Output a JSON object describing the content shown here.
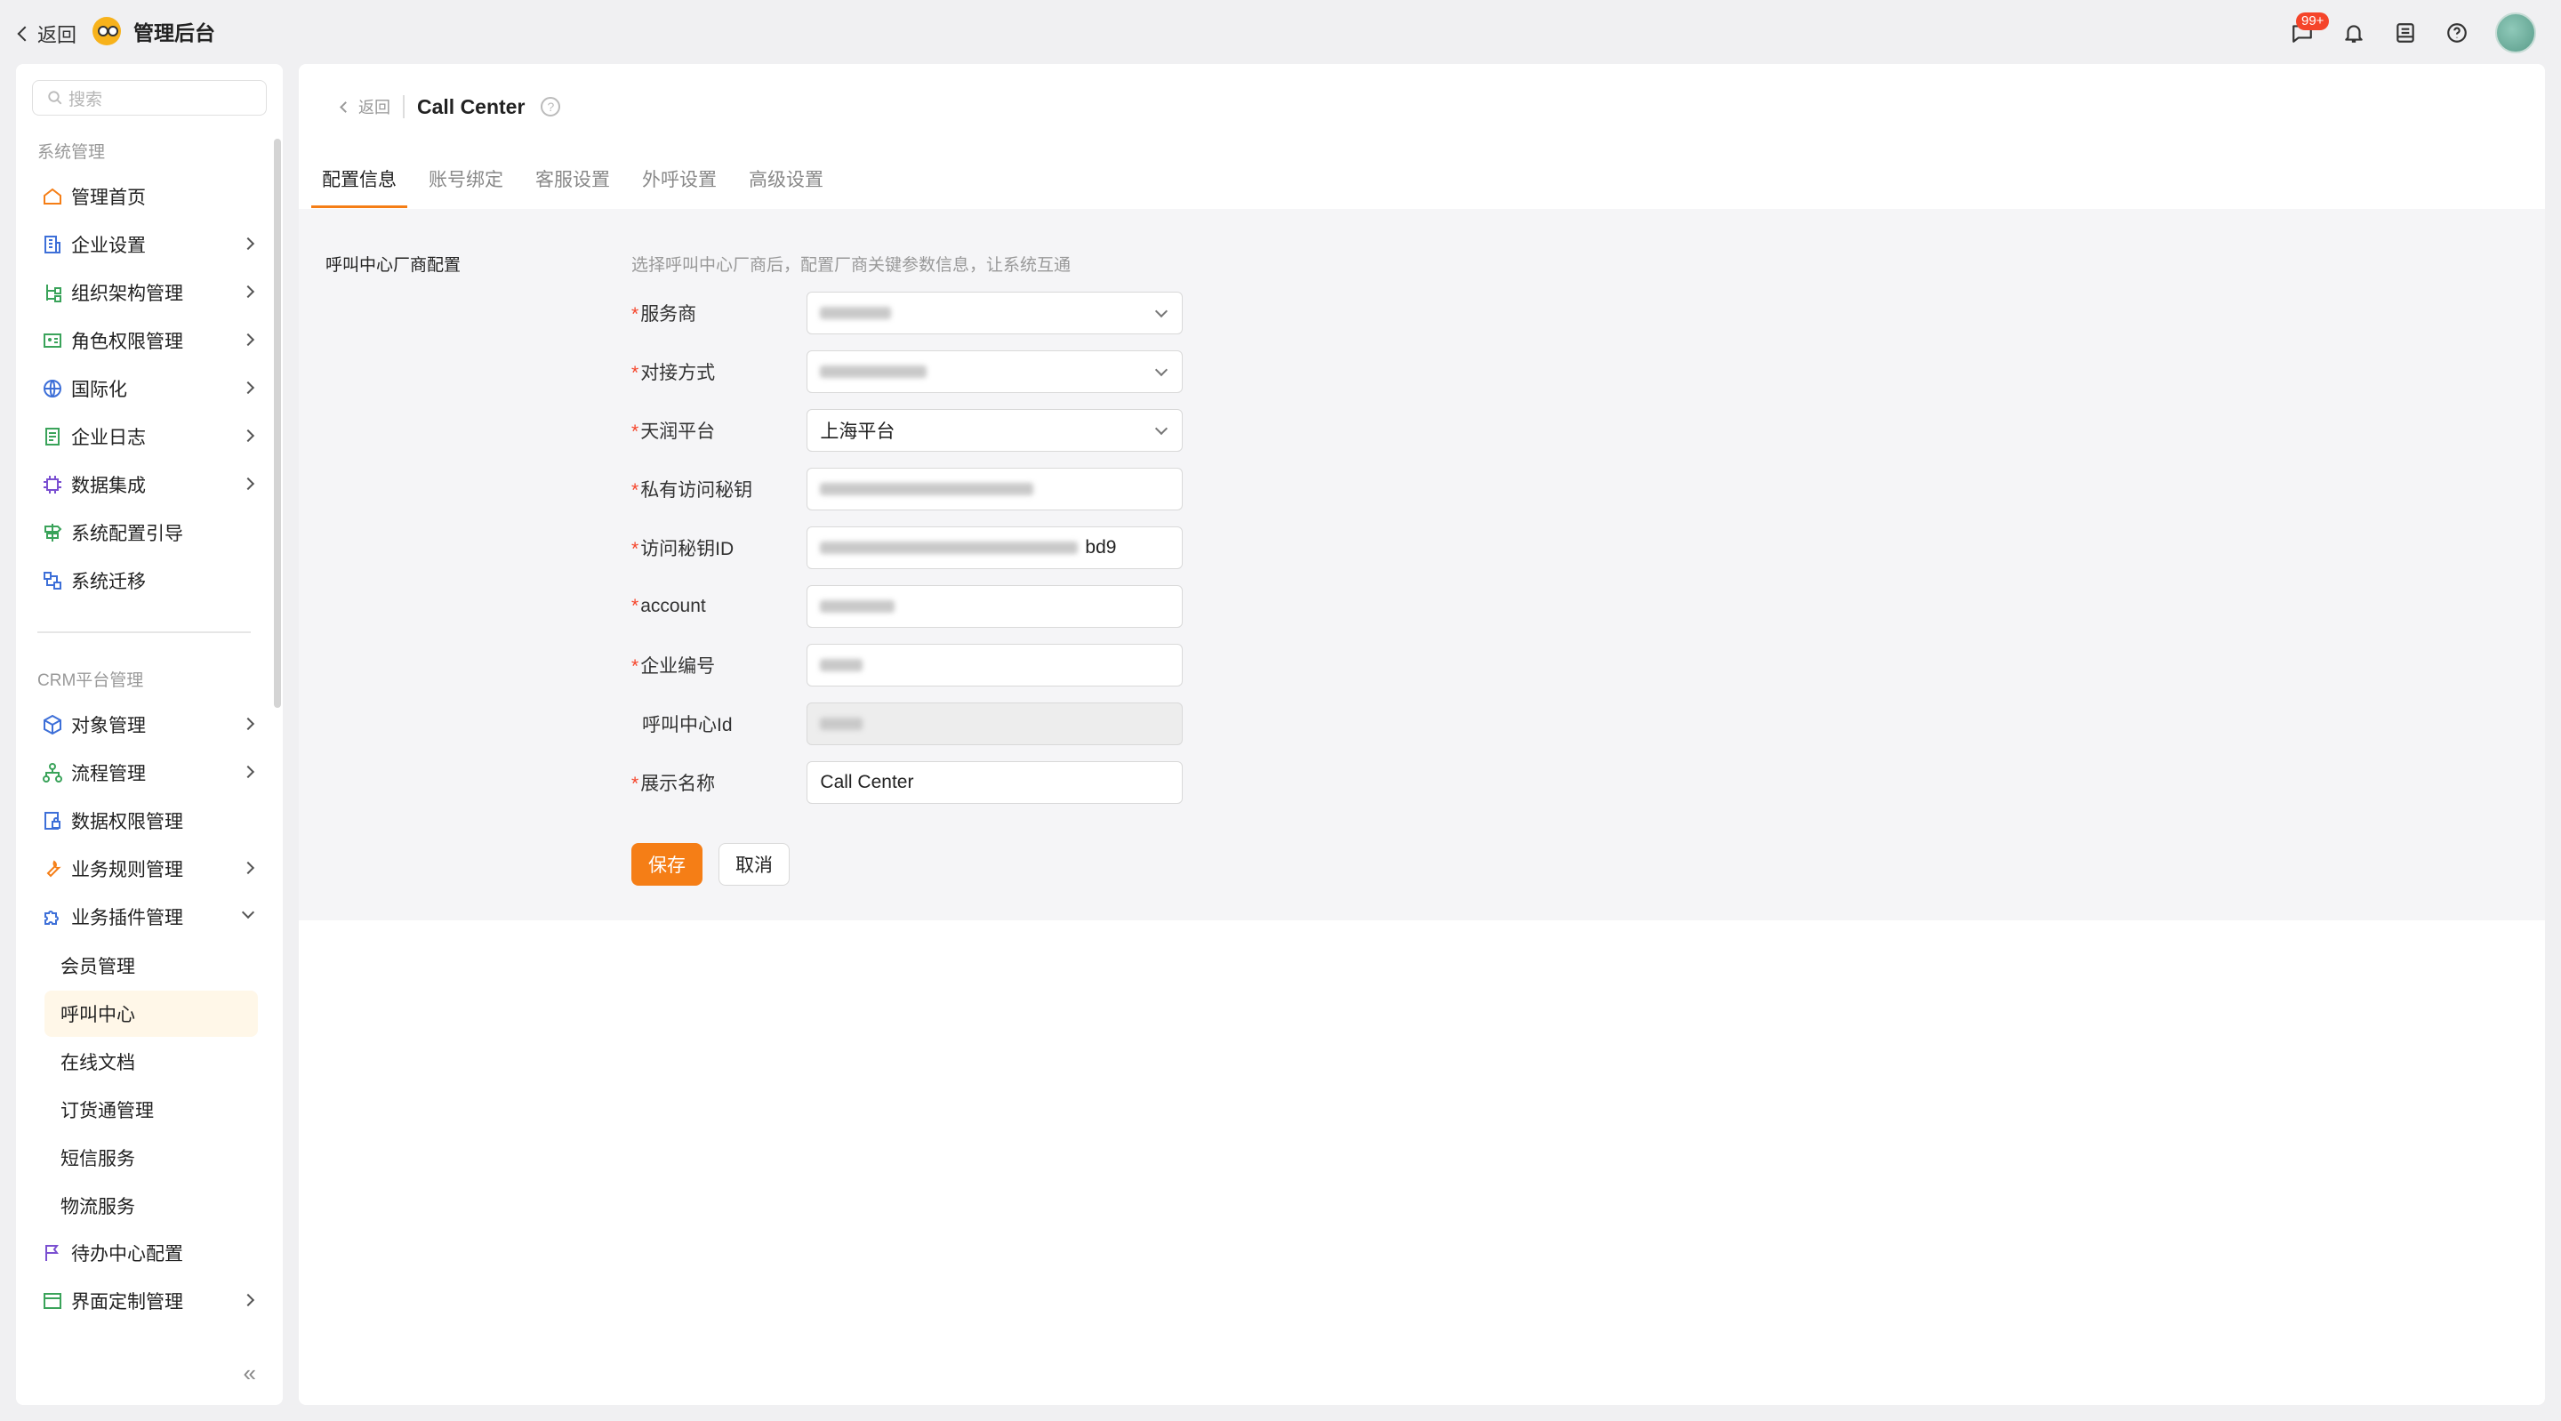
{
  "topbar": {
    "back_label": "返回",
    "app_title": "管理后台",
    "notification_badge": "99+"
  },
  "sidebar": {
    "search_placeholder": "搜索",
    "group1_label": "系统管理",
    "group1_items": [
      {
        "label": "管理首页",
        "icon": "home-icon",
        "color": "#f57e16"
      },
      {
        "label": "企业设置",
        "icon": "building-icon",
        "color": "#3d6fd8"
      },
      {
        "label": "组织架构管理",
        "icon": "org-chart-icon",
        "color": "#3aa35a"
      },
      {
        "label": "角色权限管理",
        "icon": "id-card-icon",
        "color": "#3aa35a"
      },
      {
        "label": "国际化",
        "icon": "globe-icon",
        "color": "#3d6fd8"
      },
      {
        "label": "企业日志",
        "icon": "log-icon",
        "color": "#3aa35a"
      },
      {
        "label": "数据集成",
        "icon": "chip-icon",
        "color": "#7a4fd1"
      },
      {
        "label": "系统配置引导",
        "icon": "signpost-icon",
        "color": "#3aa35a"
      },
      {
        "label": "系统迁移",
        "icon": "migrate-icon",
        "color": "#3d6fd8"
      }
    ],
    "group2_label": "CRM平台管理",
    "group2_items": [
      {
        "label": "对象管理",
        "icon": "cube-icon",
        "color": "#3d6fd8"
      },
      {
        "label": "流程管理",
        "icon": "flow-icon",
        "color": "#3aa35a"
      },
      {
        "label": "数据权限管理",
        "icon": "data-lock-icon",
        "color": "#3d6fd8"
      },
      {
        "label": "业务规则管理",
        "icon": "wrench-icon",
        "color": "#f57e16"
      },
      {
        "label": "业务插件管理",
        "icon": "puzzle-icon",
        "color": "#3d6fd8"
      }
    ],
    "plugin_subitems": [
      "会员管理",
      "呼叫中心",
      "在线文档",
      "订货通管理",
      "短信服务",
      "物流服务"
    ],
    "bottom_items": [
      {
        "label": "待办中心配置",
        "icon": "flag-icon",
        "color": "#7a4fd1"
      },
      {
        "label": "界面定制管理",
        "icon": "layout-icon",
        "color": "#3aa35a"
      }
    ]
  },
  "main": {
    "back_label": "返回",
    "title": "Call Center",
    "tabs": [
      "配置信息",
      "账号绑定",
      "客服设置",
      "外呼设置",
      "高级设置"
    ],
    "section_title": "呼叫中心厂商配置",
    "section_hint": "选择呼叫中心厂商后，配置厂商关键参数信息，让系统互通",
    "form": {
      "service_provider_label": "服务商",
      "connection_method_label": "对接方式",
      "tianrun_platform_label": "天润平台",
      "tianrun_platform_value": "上海平台",
      "private_key_label": "私有访问秘钥",
      "access_key_id_label": "访问秘钥ID",
      "access_key_id_suffix": "bd9",
      "account_label": "account",
      "enterprise_no_label": "企业编号",
      "call_center_id_label": "呼叫中心Id",
      "display_name_label": "展示名称",
      "display_name_value": "Call Center"
    },
    "save_label": "保存",
    "cancel_label": "取消"
  }
}
